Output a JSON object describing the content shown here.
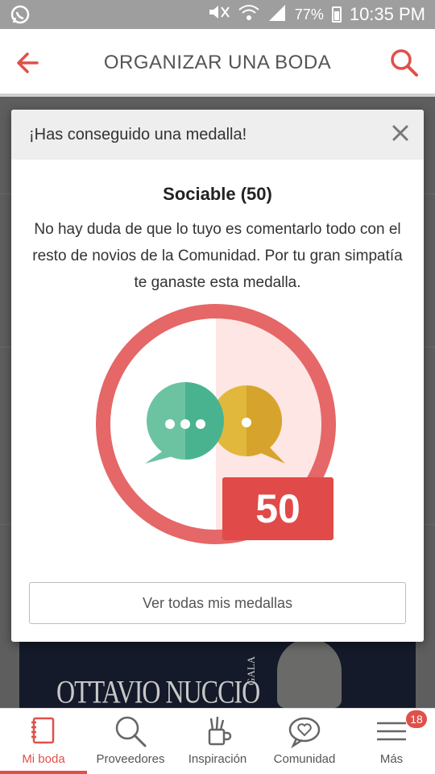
{
  "status_bar": {
    "battery_percent": "77%",
    "time": "10:35 PM",
    "icons": [
      "whatsapp-icon",
      "mute-icon",
      "wifi-icon",
      "signal-icon",
      "battery-icon"
    ]
  },
  "app_bar": {
    "title": "ORGANIZAR UNA BODA",
    "back_icon": "arrow-left-icon",
    "search_icon": "search-icon"
  },
  "dialog": {
    "title": "¡Has conseguido una medalla!",
    "close_icon": "close-icon",
    "medal_name": "Sociable (50)",
    "description": "No hay duda de que lo tuyo es comentarlo todo con el resto de novios de la Comunidad. Por tu gran simpatía te ganaste esta medalla.",
    "medal_count": "50",
    "button_label": "Ver todas mis medallas"
  },
  "background_ad": {
    "brand": "OTTAVIO NUCCIO",
    "sub": "GALA"
  },
  "bottom_nav": {
    "items": [
      {
        "label": "Mi boda",
        "icon": "notebook-icon",
        "active": true
      },
      {
        "label": "Proveedores",
        "icon": "search-icon"
      },
      {
        "label": "Inspiración",
        "icon": "pencil-cup-icon"
      },
      {
        "label": "Comunidad",
        "icon": "chat-heart-icon"
      },
      {
        "label": "Más",
        "icon": "menu-icon",
        "badge": "18"
      }
    ]
  },
  "colors": {
    "accent": "#e0504a",
    "medal_ring": "#e56767",
    "bubble_green": "#49b38f",
    "bubble_yellow": "#e2b83c"
  }
}
